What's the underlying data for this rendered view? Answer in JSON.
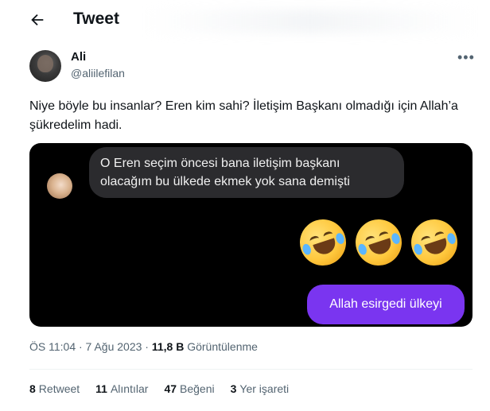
{
  "header": {
    "title": "Tweet",
    "back_icon": "arrow-left-icon"
  },
  "author": {
    "name": "Ali",
    "handle": "@aliilefilan"
  },
  "tweet": {
    "text": "Niye böyle bu insanlar? Eren kim sahi? İletişim Başkanı olmadığı için Allah’a şükredelim hadi."
  },
  "media": {
    "received_message": "O Eren seçim öncesi bana iletişim başkanı olacağım bu ülkede ekmek yok sana demişti",
    "emoji_reactions": [
      "rolling-on-floor-laughing",
      "rolling-on-floor-laughing",
      "rolling-on-floor-laughing"
    ],
    "sent_message": "Allah esirgedi ülkeyi",
    "colors": {
      "sent_bubble": "#7a35f0",
      "received_bubble": "#2b2b2e",
      "background": "#000000"
    }
  },
  "meta": {
    "time_date": "ÖS 11:04 · 7 Ağu 2023 ·",
    "views_count": "11,8 B",
    "views_label": "Görüntülenme"
  },
  "stats": [
    {
      "count": "8",
      "label": "Retweet"
    },
    {
      "count": "11",
      "label": "Alıntılar"
    },
    {
      "count": "47",
      "label": "Beğeni"
    },
    {
      "count": "3",
      "label": "Yer işareti"
    }
  ]
}
